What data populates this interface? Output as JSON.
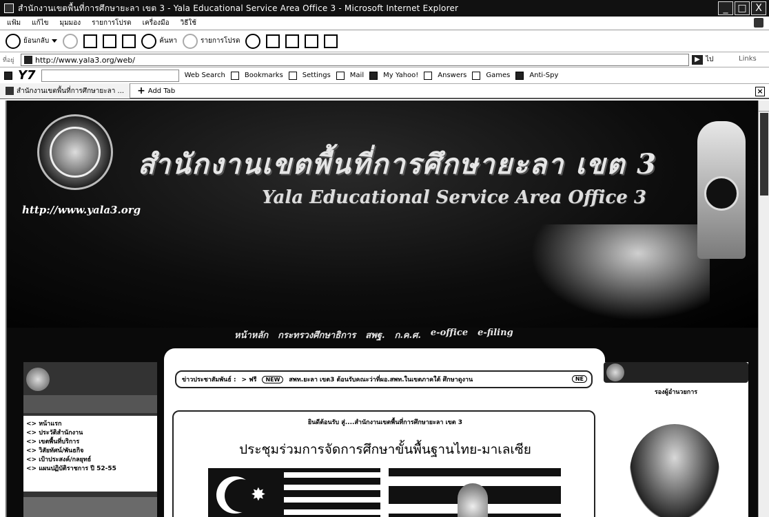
{
  "window": {
    "title": "สำนักงานเขตพื้นที่การศึกษายะลา เขต 3 - Yala Educational Service Area Office 3 - Microsoft Internet Explorer",
    "controls": [
      "_",
      "□",
      "X"
    ]
  },
  "menubar": {
    "items": [
      "แฟ้ม",
      "แก้ไข",
      "มุมมอง",
      "รายการโปรด",
      "เครื่องมือ",
      "วิธีใช้"
    ]
  },
  "toolbar": {
    "back_label": "ย้อนกลับ",
    "search_label": "ค้นหา",
    "favorites_label": "รายการโปรด"
  },
  "addressbar": {
    "label": "ที่อยู่",
    "url": "http://www.yala3.org/web/",
    "go_label": "ไป",
    "links_label": "Links"
  },
  "yahoo_toolbar": {
    "logo": "Y7",
    "items": [
      "Web Search",
      "Bookmarks",
      "Settings",
      "Mail",
      "My Yahoo!",
      "Answers",
      "Games",
      "Anti-Spy"
    ]
  },
  "tabs": {
    "active_tab": "สำนักงานเขตพื้นที่การศึกษายะลา ...",
    "add_tab_label": "Add Tab"
  },
  "page": {
    "site_url": "http://www.yala3.org",
    "thai_title": "สำนักงานเขตพื้นที่การศึกษายะลา เขต 3",
    "english_title": "Yala Educational Service Area Office 3",
    "nav": [
      "หน้าหลัก",
      "กระทรวงศึกษาธิการ",
      "สพฐ.",
      "ก.ค.ศ.",
      "e-office",
      "e-filing"
    ],
    "left_menu": [
      "<> หน้าแรก",
      "<> ประวัติสำนักงาน",
      "<> เขตพื้นที่บริการ",
      "<> วิสัยทัศน์/พันธกิจ",
      "<> เป้าประสงค์/กลยุทธ์",
      "<> แผนปฏิบัติราชการ ปี 52-55"
    ],
    "news_label": "ข่าวประชาสัมพันธ์ :",
    "news_prefix": "> ฟรี",
    "news_badge": "NEW",
    "news_text": "สพท.ยะลา เขต3 ต้อนรับคณะว่าที่ผอ.สพท.ในเขตภาคใต้ ศึกษาดูงาน",
    "news_tail_badge": "NE",
    "welcome_text": "ยินดีต้อนรับ สู่....สำนักงานเขตพื้นที่การศึกษายะลา เขต 3",
    "banner_heading": "ประชุมร่วมการจัดการศึกษาขั้นพื้นฐานไทย-มาเลเซีย",
    "right_caption": "รองผู้อำนวยการ"
  },
  "colors": {
    "page_background": "#0a0a0a",
    "panel": "#ffffff"
  }
}
